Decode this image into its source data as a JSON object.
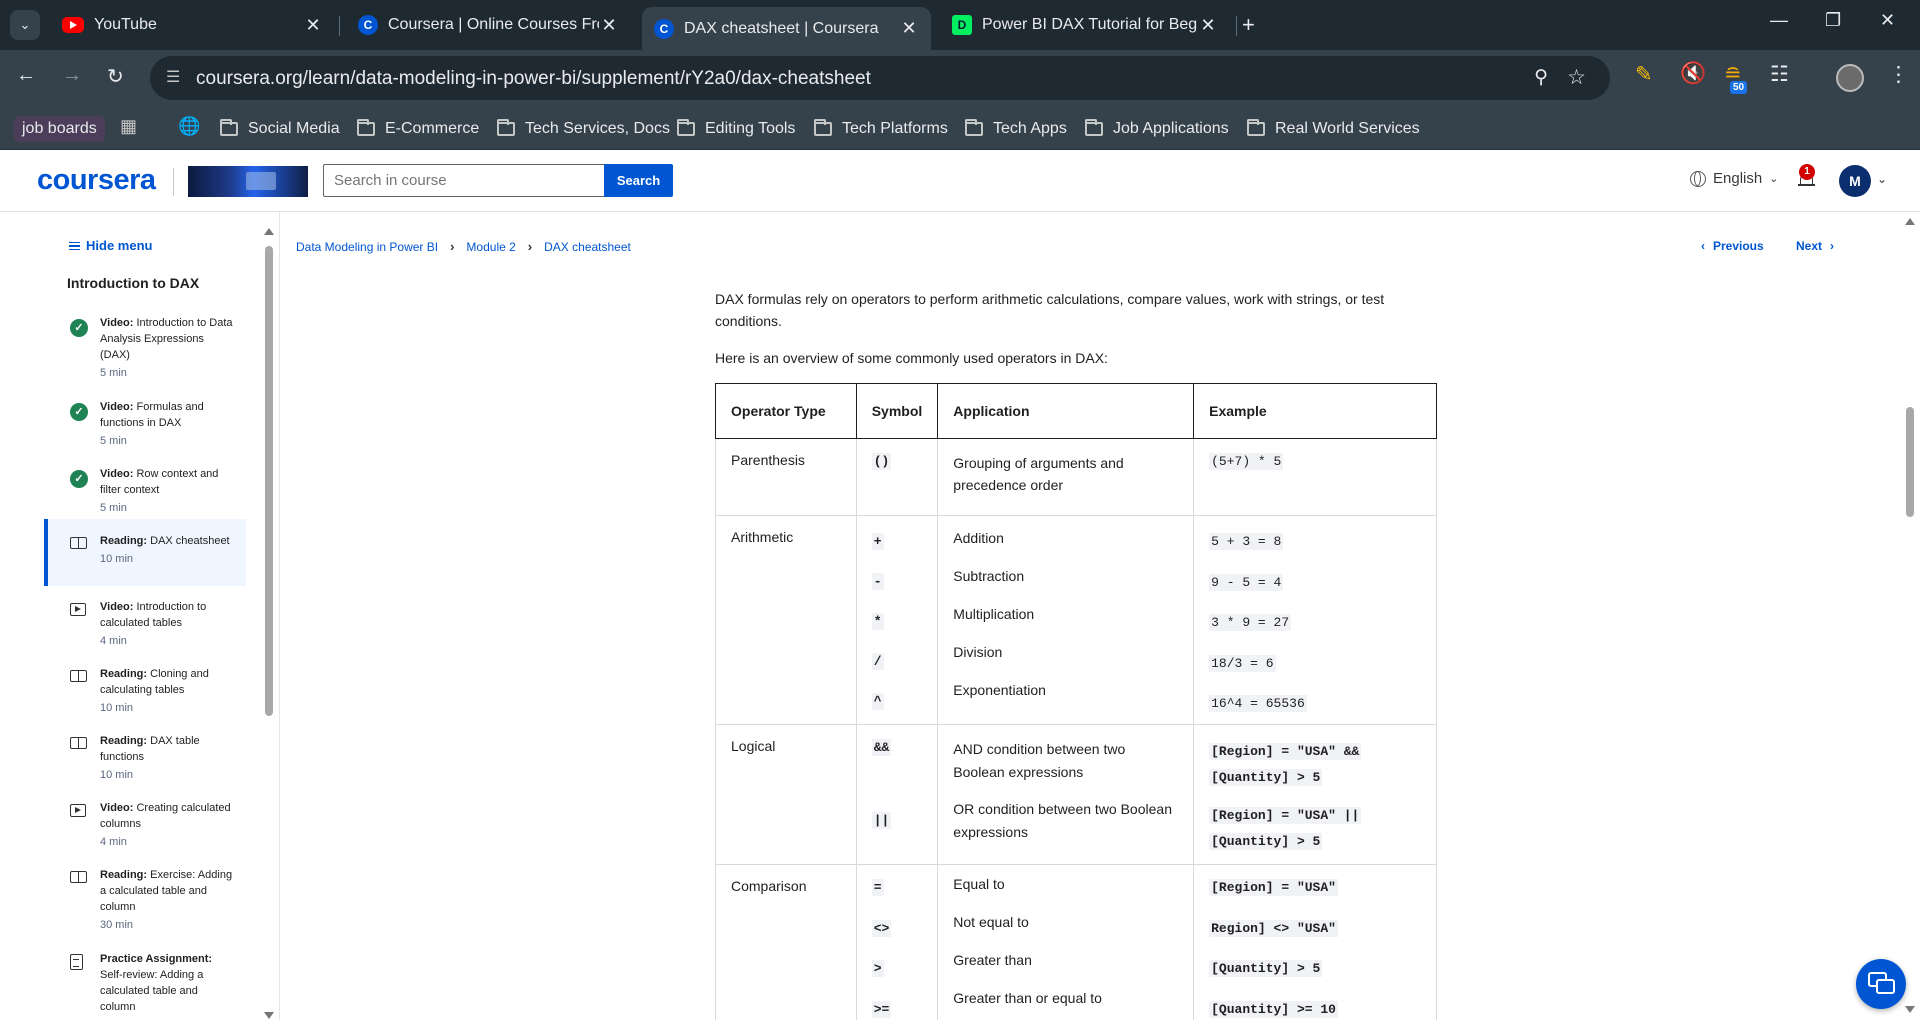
{
  "browser": {
    "tabs": [
      {
        "title": "YouTube",
        "favicon": "youtube-icon"
      },
      {
        "title": "Coursera | Online Courses From",
        "favicon": "coursera-icon"
      },
      {
        "title": "DAX cheatsheet | Coursera",
        "favicon": "coursera-icon",
        "active": true
      },
      {
        "title": "Power BI DAX Tutorial for Begin",
        "favicon": "datacamp-icon"
      }
    ],
    "url": "coursera.org/learn/data-modeling-in-power-bi/supplement/rY2a0/dax-cheatsheet",
    "extension_badge": "50",
    "bookmarks": {
      "pinned": "job boards",
      "folders": [
        "Social Media",
        "E-Commerce",
        "Tech Services, Docs",
        "Editing Tools",
        "Tech Platforms",
        "Tech Apps",
        "Job Applications",
        "Real World Services"
      ]
    }
  },
  "header": {
    "logo": "coursera",
    "search_placeholder": "Search in course",
    "search_button": "Search",
    "language": "English",
    "notification_count": "1",
    "avatar_initial": "M",
    "accent_color": "#0056d2"
  },
  "sidebar": {
    "hide_menu": "Hide menu",
    "module_title": "Introduction to DAX",
    "items": [
      {
        "kind": "Video:",
        "title": "Introduction to Data Analysis Expressions (DAX)",
        "duration": "5 min",
        "status": "completed"
      },
      {
        "kind": "Video:",
        "title": "Formulas and functions in DAX",
        "duration": "5 min",
        "status": "completed"
      },
      {
        "kind": "Video:",
        "title": "Row context and filter context",
        "duration": "5 min",
        "status": "completed"
      },
      {
        "kind": "Reading:",
        "title": "DAX cheatsheet",
        "duration": "10 min",
        "status": "active"
      },
      {
        "kind": "Video:",
        "title": "Introduction to calculated tables",
        "duration": "4 min"
      },
      {
        "kind": "Reading:",
        "title": "Cloning and calculating tables",
        "duration": "10 min"
      },
      {
        "kind": "Reading:",
        "title": "DAX table functions",
        "duration": "10 min"
      },
      {
        "kind": "Video:",
        "title": "Creating calculated columns",
        "duration": "4 min"
      },
      {
        "kind": "Reading:",
        "title": "Exercise: Adding a calculated table and column",
        "duration": "30 min"
      },
      {
        "kind": "Practice Assignment:",
        "title": "Self-review: Adding a calculated table and column",
        "duration": ""
      }
    ]
  },
  "breadcrumb": [
    "Data Modeling in Power BI",
    "Module 2",
    "DAX cheatsheet"
  ],
  "pager": {
    "previous": "Previous",
    "next": "Next"
  },
  "content": {
    "intro": "DAX formulas rely on operators to perform arithmetic calculations, compare values, work with strings, or test conditions.",
    "overview": "Here is an overview of some commonly used operators in DAX:",
    "table": {
      "headers": [
        "Operator Type",
        "Symbol",
        "Application",
        "Example"
      ],
      "groups": [
        {
          "type": "Parenthesis",
          "rows": [
            {
              "symbol": "()",
              "application": "Grouping of arguments and precedence order",
              "example": "(5+7) * 5"
            }
          ]
        },
        {
          "type": "Arithmetic",
          "rows": [
            {
              "symbol": "+",
              "application": "Addition",
              "example": "5 + 3 = 8"
            },
            {
              "symbol": "-",
              "application": "Subtraction",
              "example": "9 - 5 = 4"
            },
            {
              "symbol": "*",
              "application": "Multiplication",
              "example": "3 * 9 = 27"
            },
            {
              "symbol": "/",
              "application": "Division",
              "example": "18/3 = 6"
            },
            {
              "symbol": "^",
              "application": "Exponentiation",
              "example": "16^4 = 65536"
            }
          ]
        },
        {
          "type": "Logical",
          "rows": [
            {
              "symbol": "&&",
              "application": "AND condition between two Boolean expressions",
              "example_lines": [
                "[Region] = \"USA\" &&",
                "[Quantity] > 5"
              ]
            },
            {
              "symbol": "||",
              "application": "OR condition between two Boolean expressions",
              "example_lines": [
                "[Region] = \"USA\" ||",
                "[Quantity] > 5"
              ]
            }
          ]
        },
        {
          "type": "Comparison",
          "rows": [
            {
              "symbol": "=",
              "application": "Equal to",
              "example": "[Region] = \"USA\""
            },
            {
              "symbol": "<>",
              "application": "Not equal to",
              "example": "Region] <> \"USA\""
            },
            {
              "symbol": ">",
              "application": "Greater than",
              "example": "[Quantity] > 5"
            },
            {
              "symbol": ">=",
              "application": "Greater than or equal to",
              "example": "[Quantity] >= 10"
            }
          ]
        }
      ]
    }
  }
}
